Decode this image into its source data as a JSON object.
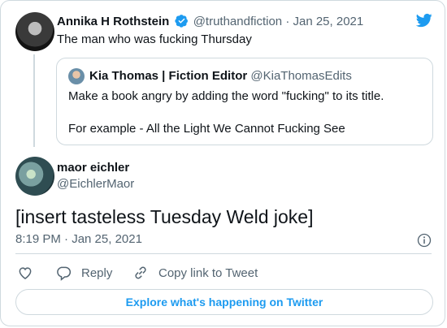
{
  "parent": {
    "name": "Annika H Rothstein",
    "handle": "@truthandfiction",
    "sep": "·",
    "date": "Jan 25, 2021",
    "text": "The man who was fucking Thursday"
  },
  "quote": {
    "name": "Kia Thomas | Fiction Editor",
    "handle": "@KiaThomasEdits",
    "line1": "Make a book angry by adding the word \"fucking\" to its title.",
    "line2": "For example - All the Light We Cannot Fucking See"
  },
  "tweet": {
    "name": "maor eichler",
    "handle": "@EichlerMaor",
    "text": "[insert tasteless Tuesday Weld joke]",
    "time": "8:19 PM · Jan 25, 2021"
  },
  "actions": {
    "reply": "Reply",
    "copy": "Copy link to Tweet"
  },
  "explore": "Explore what's happening on Twitter",
  "colors": {
    "accent": "#1d9bf0",
    "muted": "#536471",
    "border": "#cfd9de"
  }
}
